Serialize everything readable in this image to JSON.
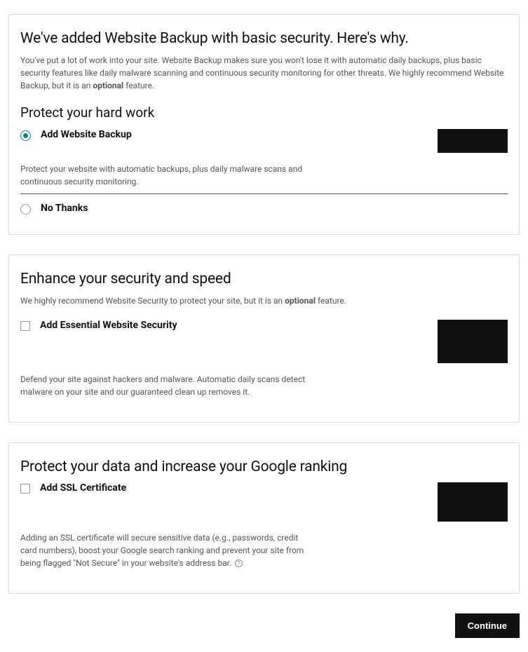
{
  "card1": {
    "title": "We've added Website Backup with basic security. Here's why.",
    "desc_pre": "You've put a lot of work into your site. Website Backup makes sure you won't lose it with automatic daily backups, plus basic security features like daily malware scanning and continuous security monitoring for other threats. We highly recommend Website Backup, but it is an ",
    "desc_bold": "optional",
    "desc_post": " feature.",
    "subhead": "Protect your hard work",
    "option1_label": "Add Website Backup",
    "option1_desc": "Protect your website with automatic backups, plus daily malware scans and continuous security monitoring.",
    "option2_label": "No Thanks"
  },
  "card2": {
    "title": "Enhance your security and speed",
    "desc_pre": "We highly recommend Website Security to protect your site, but it is an ",
    "desc_bold": "optional",
    "desc_post": " feature.",
    "option_label": "Add Essential Website Security",
    "option_desc": "Defend your site against hackers and malware. Automatic daily scans detect malware on your site and our guaranteed clean up removes it."
  },
  "card3": {
    "title": "Protect your data and increase your Google ranking",
    "option_label": "Add SSL Certificate",
    "option_desc": "Adding an SSL certificate will secure sensitive data (e.g., passwords, credit card numbers), boost your Google search ranking and prevent your site from being flagged \"Not Secure\" in your website's address bar."
  },
  "continue_label": "Continue"
}
